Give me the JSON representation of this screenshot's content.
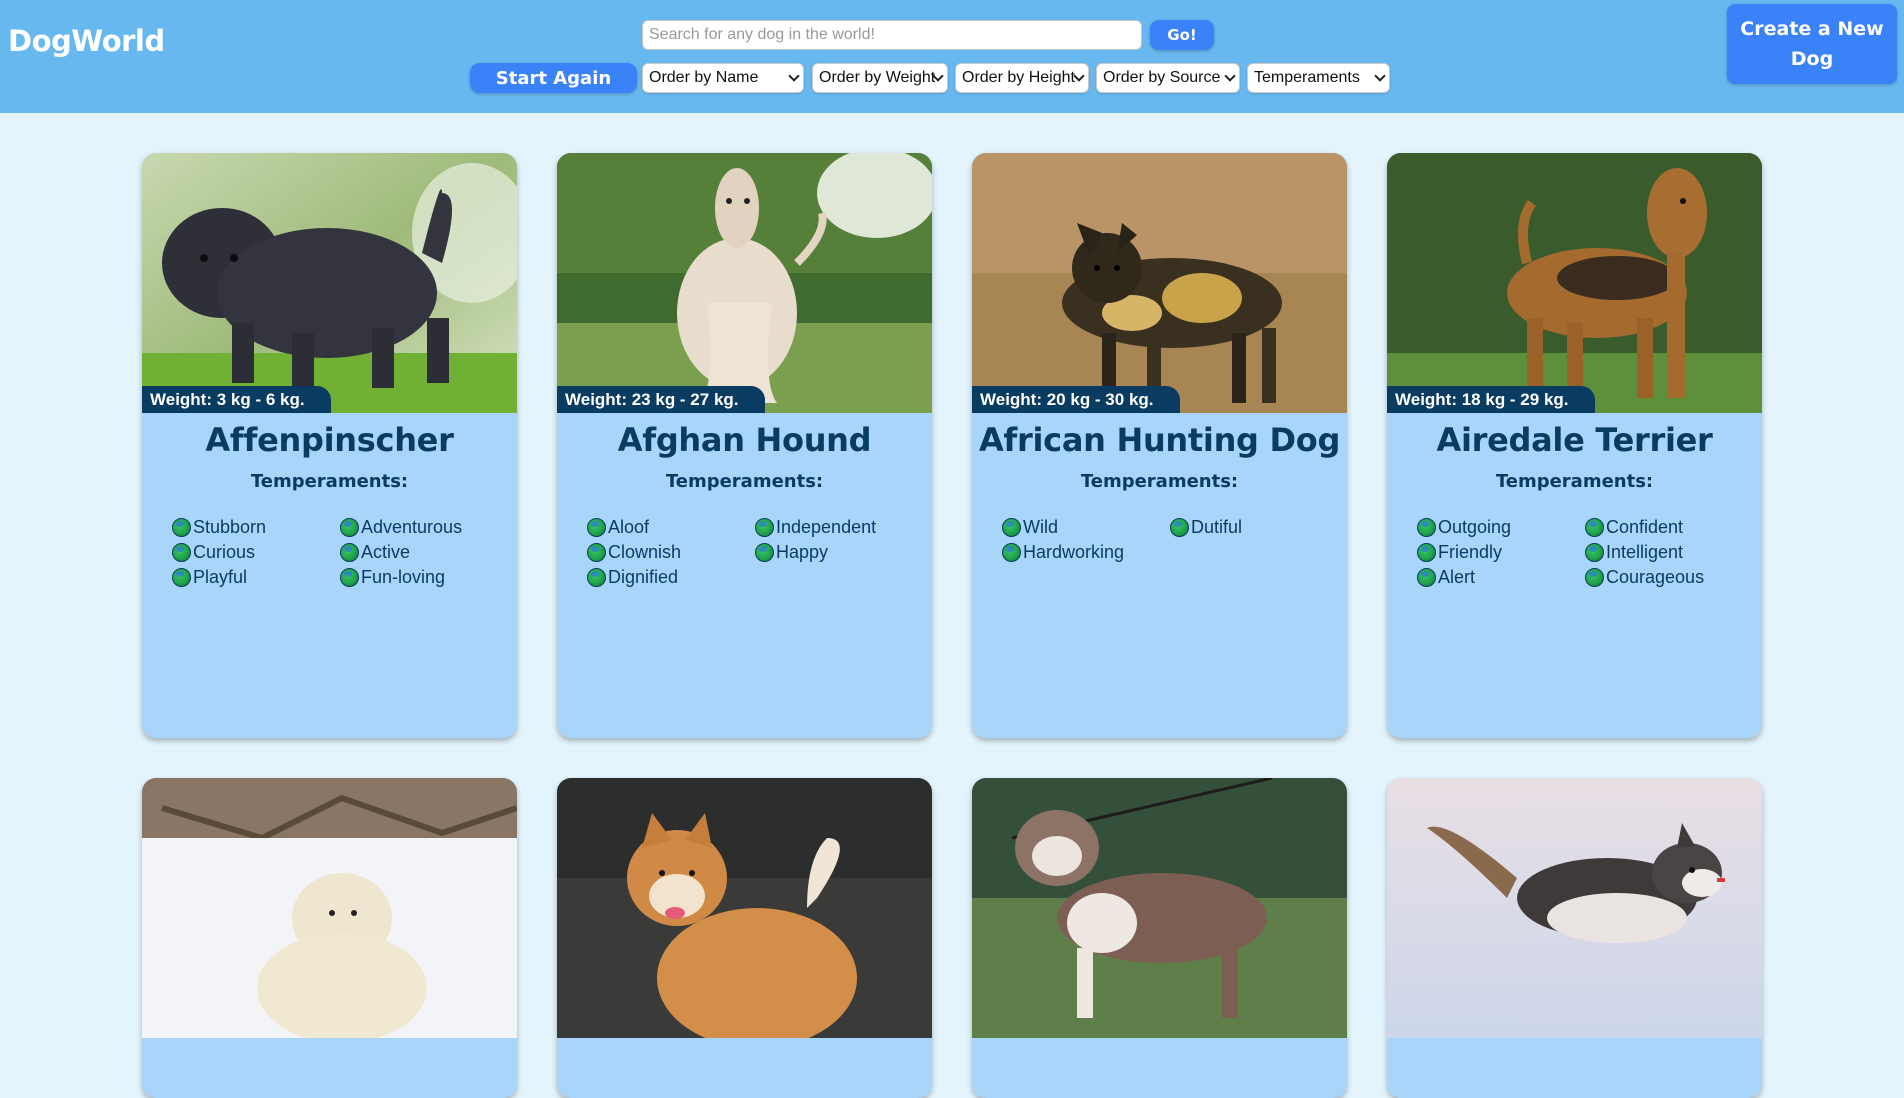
{
  "header": {
    "logo": "DogWorld",
    "search_placeholder": "Search for any dog in the world!",
    "go_label": "Go!",
    "start_again_label": "Start Again",
    "create_label": "Create a New Dog",
    "filters": {
      "name": "Order by Name",
      "weight": "Order by Weight",
      "height": "Order by Height",
      "source": "Order by Source",
      "temperaments": "Temperaments"
    }
  },
  "temperaments_heading": "Temperaments:",
  "dogs": [
    {
      "name": "Affenpinscher",
      "weight": "Weight: 3 kg - 6 kg.",
      "temperaments": [
        "Stubborn",
        "Adventurous",
        "Curious",
        "Active",
        "Playful",
        "Fun-loving"
      ]
    },
    {
      "name": "Afghan Hound",
      "weight": "Weight: 23 kg - 27 kg.",
      "temperaments": [
        "Aloof",
        "Independent",
        "Clownish",
        "Happy",
        "Dignified"
      ]
    },
    {
      "name": "African Hunting Dog",
      "weight": "Weight: 20 kg - 30 kg.",
      "temperaments": [
        "Wild",
        "Dutiful",
        "Hardworking"
      ]
    },
    {
      "name": "Airedale Terrier",
      "weight": "Weight: 18 kg - 29 kg.",
      "temperaments": [
        "Outgoing",
        "Confident",
        "Friendly",
        "Intelligent",
        "Alert",
        "Courageous"
      ]
    }
  ],
  "colors": {
    "header_bg": "#68b8f0",
    "page_bg": "#e3f4fd",
    "card_bg": "#a9d5fa",
    "accent_button": "#3a82f7",
    "text_dark": "#0a3c62"
  }
}
